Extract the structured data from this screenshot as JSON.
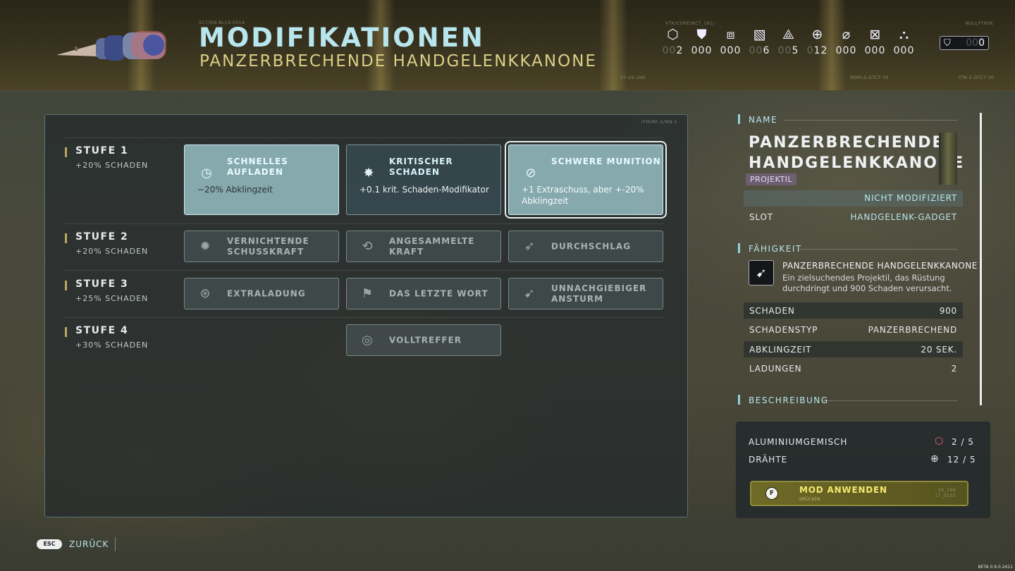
{
  "header": {
    "title": "MODIFIKATIONEN",
    "subtitle": "PANZERBRECHENDE HANDGELENKKANONE",
    "code_left": "SCT/DN-BLCK-001A",
    "code_a": "ST-US-1N0",
    "code_b": "MDRLS-DTCT-30",
    "code_c": "ITM-5-DTCT-30",
    "code_d": "VTK/CORE/NCT_161/",
    "code_e": "NULLPTR0K"
  },
  "resources": [
    {
      "icon": "hexagon-icon",
      "glyph": "⬡",
      "dim": "00",
      "value": "2"
    },
    {
      "icon": "armor-icon",
      "glyph": "⛊",
      "dim": "",
      "value": "000"
    },
    {
      "icon": "frame-icon",
      "glyph": "⧈",
      "dim": "",
      "value": "000"
    },
    {
      "icon": "plate-icon",
      "glyph": "▧",
      "dim": "00",
      "value": "6"
    },
    {
      "icon": "nodes-icon",
      "glyph": "⟁",
      "dim": "00",
      "value": "5"
    },
    {
      "icon": "crosshair-icon",
      "glyph": "⊕",
      "dim": "0",
      "value": "12"
    },
    {
      "icon": "tube-icon",
      "glyph": "⌀",
      "dim": "",
      "value": "000"
    },
    {
      "icon": "box-x-icon",
      "glyph": "⊠",
      "dim": "",
      "value": "000"
    },
    {
      "icon": "cluster-icon",
      "glyph": "⛬",
      "dim": "",
      "value": "000"
    }
  ],
  "credits": {
    "dim": "00",
    "value": "0"
  },
  "panel_code": "ITM/MF-S/MN-5",
  "tiers": [
    {
      "name": "STUFE 1",
      "bonus": "+20% SCHADEN"
    },
    {
      "name": "STUFE 2",
      "bonus": "+20% SCHADEN"
    },
    {
      "name": "STUFE 3",
      "bonus": "+25% SCHADEN"
    },
    {
      "name": "STUFE 4",
      "bonus": "+30% SCHADEN"
    }
  ],
  "mods": {
    "t1": [
      {
        "label": "SCHNELLES AUFLADEN",
        "desc": "−20% Abklingzeit",
        "icon": "timer-icon",
        "glyph": "◷"
      },
      {
        "label": "KRITISCHER SCHADEN",
        "desc": "+0.1 krit. Schaden-Modifikator",
        "icon": "crit-burst-icon",
        "glyph": "✸"
      },
      {
        "label": "SCHWERE MUNITION",
        "desc": "+1 Extraschuss, aber +-20% Abklingzeit",
        "icon": "heavy-ammo-icon",
        "glyph": "⊘"
      }
    ],
    "t2": [
      {
        "label": "VERNICHTENDE SCHUSSKRAFT",
        "l1": "VERNICHTENDE",
        "l2": "SCHUSSKRAFT",
        "icon": "blast-icon",
        "glyph": "✹"
      },
      {
        "label": "ANGESAMMELTE KRAFT",
        "l1": "ANGESAMMELTE",
        "l2": "KRAFT",
        "icon": "stack-power-icon",
        "glyph": "⟲"
      },
      {
        "label": "DURCHSCHLAG",
        "l1": "DURCHSCHLAG",
        "l2": "",
        "icon": "pierce-icon",
        "glyph": "➶"
      }
    ],
    "t3": [
      {
        "label": "EXTRALADUNG",
        "l1": "EXTRALADUNG",
        "l2": "",
        "icon": "extra-charge-icon",
        "glyph": "⊛"
      },
      {
        "label": "DAS LETZTE WORT",
        "l1": "DAS LETZTE WORT",
        "l2": "",
        "icon": "last-word-icon",
        "glyph": "⚑"
      },
      {
        "label": "UNNACHGIEBIGER ANSTURM",
        "l1": "UNNACHGIEBIGER",
        "l2": "ANSTURM",
        "icon": "onslaught-icon",
        "glyph": "➹"
      }
    ],
    "t4": [
      {
        "label": "VOLLTREFFER",
        "l1": "VOLLTREFFER",
        "l2": "",
        "icon": "direct-hit-icon",
        "glyph": "◎"
      }
    ]
  },
  "details": {
    "name_header": "NAME",
    "name_l1": "PANZERBRECHENDE",
    "name_l2": "HANDGELENKKANONE",
    "category": "PROJEKTIL",
    "status": "NICHT MODIFIZIERT",
    "slot_label": "SLOT",
    "slot_value": "HANDGELENK-GADGET",
    "ability_header": "FÄHIGKEIT",
    "ability_title": "PANZERBRECHENDE HANDGELENKKANONE",
    "ability_desc": "Ein zielsuchendes Projektil, das Rüstung durchdringt und 900 Schaden verursacht.",
    "stats": [
      {
        "k": "SCHADEN",
        "v": "900"
      },
      {
        "k": "SCHADENSTYP",
        "v": "PANZERBRECHEND"
      },
      {
        "k": "ABKLINGZEIT",
        "v": "20 SEK."
      },
      {
        "k": "LADUNGEN",
        "v": "2"
      }
    ],
    "desc_header": "BESCHREIBUNG"
  },
  "costs": [
    {
      "name": "ALUMINIUMGEMISCH",
      "value": "2 / 5",
      "icon": "hexagon-icon",
      "color": "#e0607a"
    },
    {
      "name": "DRÄHTE",
      "value": "12 / 5",
      "icon": "crosshair-icon",
      "color": "#e8eaec"
    }
  ],
  "apply": {
    "key": "F",
    "label": "MOD ANWENDEN",
    "sub": "DRÜCKEN",
    "code1": "16_128",
    "code2": "17_0232"
  },
  "footer": {
    "esc": "ESC",
    "back": "ZURÜCK",
    "build": "BETA 0.9.0.2411"
  }
}
